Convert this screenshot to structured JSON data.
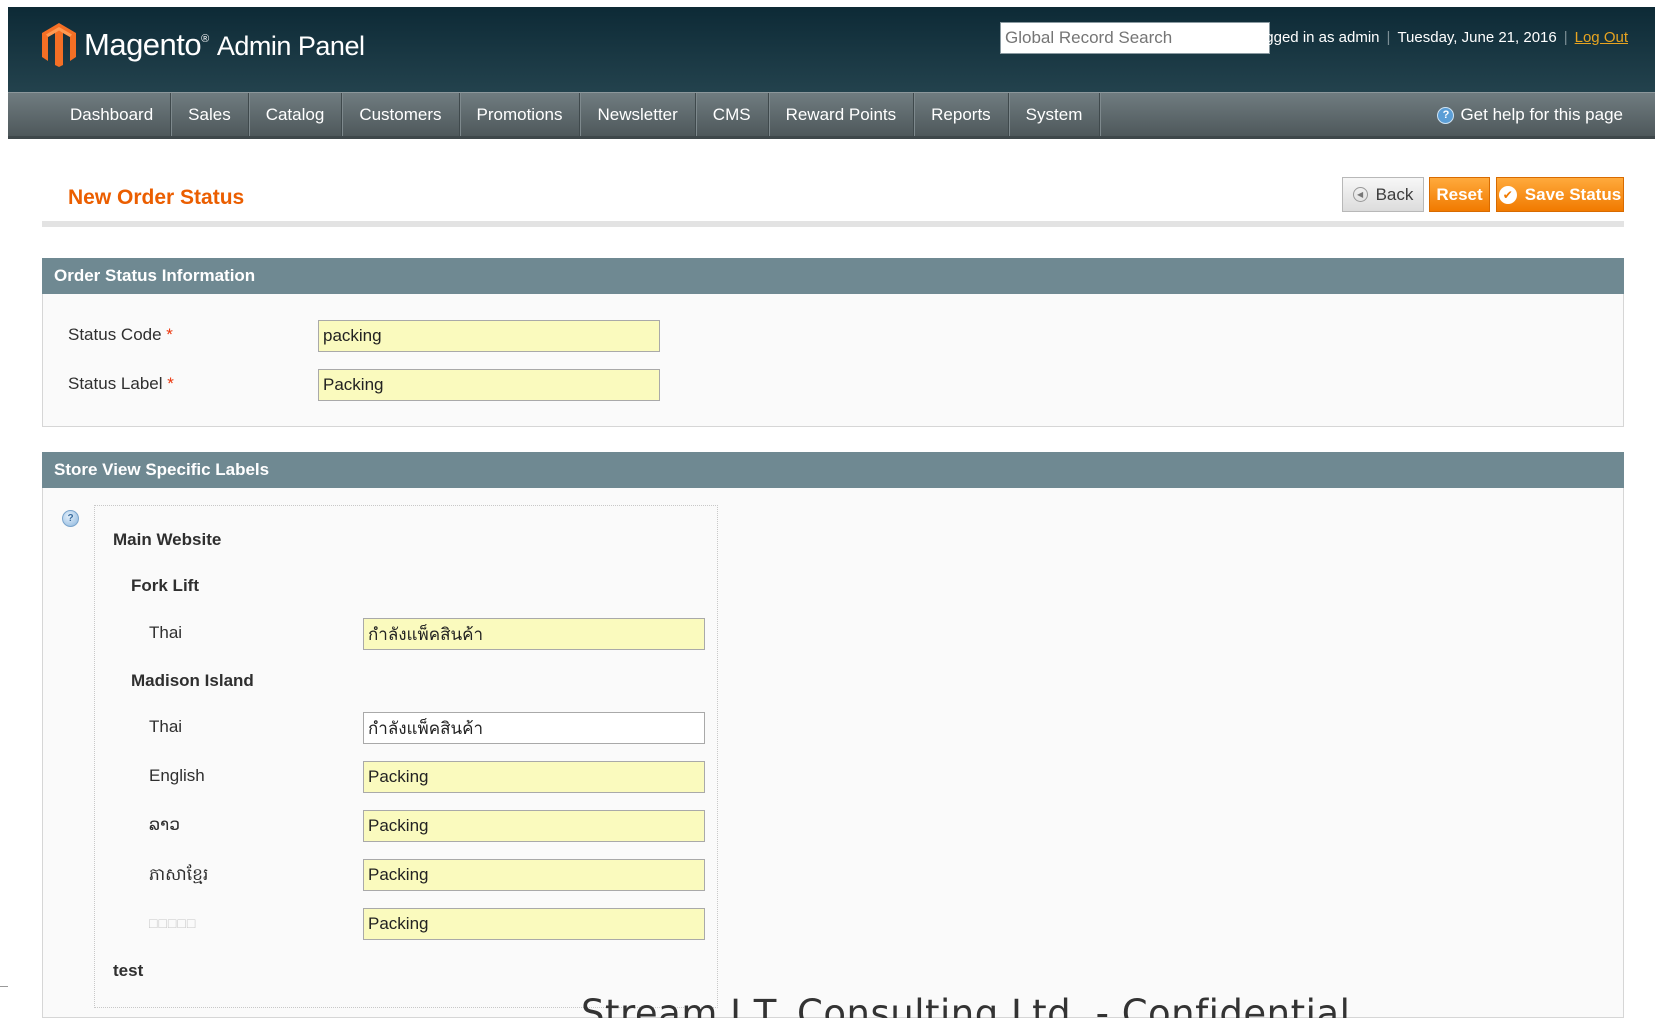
{
  "header": {
    "brand": "Magento",
    "brand_tm": "®",
    "brand_sub": "Admin Panel",
    "search_placeholder": "Global Record Search",
    "logged_in": "Logged in as admin",
    "date": "Tuesday, June 21, 2016",
    "logout": "Log Out"
  },
  "nav": {
    "items": [
      "Dashboard",
      "Sales",
      "Catalog",
      "Customers",
      "Promotions",
      "Newsletter",
      "CMS",
      "Reward Points",
      "Reports",
      "System"
    ],
    "help": "Get help for this page"
  },
  "page": {
    "title": "New Order Status",
    "buttons": {
      "back": "Back",
      "reset": "Reset",
      "save": "Save Status"
    }
  },
  "info_section": {
    "title": "Order Status Information",
    "status_code_label": "Status Code",
    "status_code_value": "packing",
    "status_label_label": "Status Label",
    "status_label_value": "Packing",
    "required_mark": "*"
  },
  "store_section": {
    "title": "Store View Specific Labels",
    "website": "Main Website",
    "fork_lift": {
      "name": "Fork Lift",
      "thai_label": "Thai",
      "thai_value": "กำลังแพ็คสินค้า"
    },
    "madison": {
      "name": "Madison Island",
      "rows": [
        {
          "label": "Thai",
          "value": "กำลังแพ็คสินค้า"
        },
        {
          "label": "English",
          "value": "Packing"
        },
        {
          "label": "ລາວ",
          "value": "Packing"
        },
        {
          "label": "ភាសាខ្មែរ",
          "value": "Packing"
        },
        {
          "label": "□□□□□",
          "value": "Packing"
        }
      ]
    },
    "test_group": "test"
  },
  "footer": {
    "text": "Stream I.T. Consulting Ltd. - Confidential"
  },
  "colors": {
    "header_bg": "#0d2a36",
    "nav_bg": "#5e696c",
    "accent": "#eb5e00",
    "section_head": "#6f8992",
    "required_field_bg": "#fafabe"
  }
}
